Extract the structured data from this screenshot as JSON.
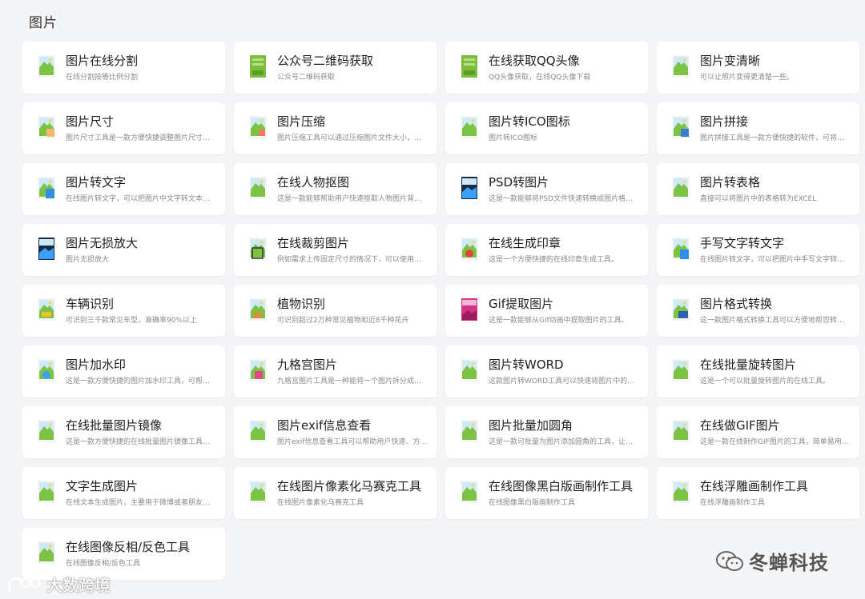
{
  "section": {
    "title": "图片"
  },
  "tools": [
    {
      "title": "图片在线分割",
      "desc": "在线分割按等比例分割",
      "icon": "image-icon"
    },
    {
      "title": "公众号二维码获取",
      "desc": "公众号二维码获取",
      "icon": "note-book-icon"
    },
    {
      "title": "在线获取QQ头像",
      "desc": "QQ头像获取，在线QQ头像下载",
      "icon": "note-book-icon"
    },
    {
      "title": "图片变清晰",
      "desc": "可以让照片变得更清楚一些。",
      "icon": "image-icon"
    },
    {
      "title": "图片尺寸",
      "desc": "图片尺寸工具是一款方便快捷调整图片尺寸…",
      "icon": "image-resize-icon"
    },
    {
      "title": "图片压缩",
      "desc": "图片压缩工具可以通过压缩图片文件大小，…",
      "icon": "image-compress-icon"
    },
    {
      "title": "图片转ICO图标",
      "desc": "图片转ICO图标",
      "icon": "image-icon"
    },
    {
      "title": "图片拼接",
      "desc": "图片拼接工具是一款方便快捷的软件，可将…",
      "icon": "image-join-icon"
    },
    {
      "title": "图片转文字",
      "desc": "在线图片转文字，可以把图片中文字转文本…",
      "icon": "image-to-text-icon"
    },
    {
      "title": "在线人物抠图",
      "desc": "这是一款能够帮助用户快速抠取人物图片背…",
      "icon": "image-icon"
    },
    {
      "title": "PSD转图片",
      "desc": "这是一款能够将PSD文件快速转换成图片格…",
      "icon": "psd-icon"
    },
    {
      "title": "图片转表格",
      "desc": "直接可以将图片中的表格转为EXCEL",
      "icon": "image-icon"
    },
    {
      "title": "图片无损放大",
      "desc": "图片无损放大",
      "icon": "psd-icon"
    },
    {
      "title": "在线裁剪图片",
      "desc": "例如需求上传固定尺寸的情况下，可以使用…",
      "icon": "image-crop-icon"
    },
    {
      "title": "在线生成印章",
      "desc": "这是一个方便快捷的在线印章生成工具。",
      "icon": "stamp-icon"
    },
    {
      "title": "手写文字转文字",
      "desc": "在线图片转文字，可以把图片中手写文字转…",
      "icon": "image-to-text-icon"
    },
    {
      "title": "车辆识别",
      "desc": "可识别三千款常见车型，准确率90%以上",
      "icon": "car-icon"
    },
    {
      "title": "植物识别",
      "desc": "可识别超过2万种常见植物和近8千种花卉",
      "icon": "plant-icon"
    },
    {
      "title": "Gif提取图片",
      "desc": "这是一款能够从Gif动画中提取图片的工具。",
      "icon": "gif-icon"
    },
    {
      "title": "图片格式转换",
      "desc": "这一款图片格式转换工具可以方便地帮您转…",
      "icon": "image-convert-icon"
    },
    {
      "title": "图片加水印",
      "desc": "这是一款方便快捷的图片加水印工具，可帮…",
      "icon": "image-watermark-icon"
    },
    {
      "title": "九格宫图片",
      "desc": "九格宫图片工具是一种能将一个图片拆分成…",
      "icon": "nine-grid-icon"
    },
    {
      "title": "图片转WORD",
      "desc": "这款图片转WORD工具可以快速将图片中的…",
      "icon": "image-icon"
    },
    {
      "title": "在线批量旋转图片",
      "desc": "这是一个可以批量旋转图片的在线工具。",
      "icon": "image-icon"
    },
    {
      "title": "在线批量图片镜像",
      "desc": "这是一款方便快捷的在线批量图片镜像工具…",
      "icon": "image-icon"
    },
    {
      "title": "图片exif信息查看",
      "desc": "图片exif信息查看工具可以帮助用户快速、方…",
      "icon": "image-icon"
    },
    {
      "title": "图片批量加圆角",
      "desc": "这是一款可批量为图片添加圆角的工具，让…",
      "icon": "image-icon"
    },
    {
      "title": "在线做GIF图片",
      "desc": "这是一款在线制作GIF图片的工具，简单易用…",
      "icon": "image-icon"
    },
    {
      "title": "文字生成图片",
      "desc": "在线文本生成图片，主要用于微博或者朋友…",
      "icon": "image-icon"
    },
    {
      "title": "在线图片像素化马赛克工具",
      "desc": "在线图片像素化马赛克工具",
      "icon": "image-icon"
    },
    {
      "title": "在线图像黑白版画制作工具",
      "desc": "在线图像黑白版画制作工具",
      "icon": "image-icon"
    },
    {
      "title": "在线浮雕画制作工具",
      "desc": "在线浮雕画制作工具",
      "icon": "image-icon"
    },
    {
      "title": "在线图像反相/反色工具",
      "desc": "在线图像反相/反色工具",
      "icon": "image-icon"
    }
  ],
  "watermarks": {
    "right": "冬蝉科技",
    "left": "大数跨境"
  },
  "colors": {
    "page_bg": "#f4f5f7",
    "card_bg": "#ffffff",
    "title_text": "#1f1f1f",
    "desc_text": "#8a8a8a",
    "icon_green": "#7cc243",
    "icon_sky": "#cfeaf7"
  }
}
